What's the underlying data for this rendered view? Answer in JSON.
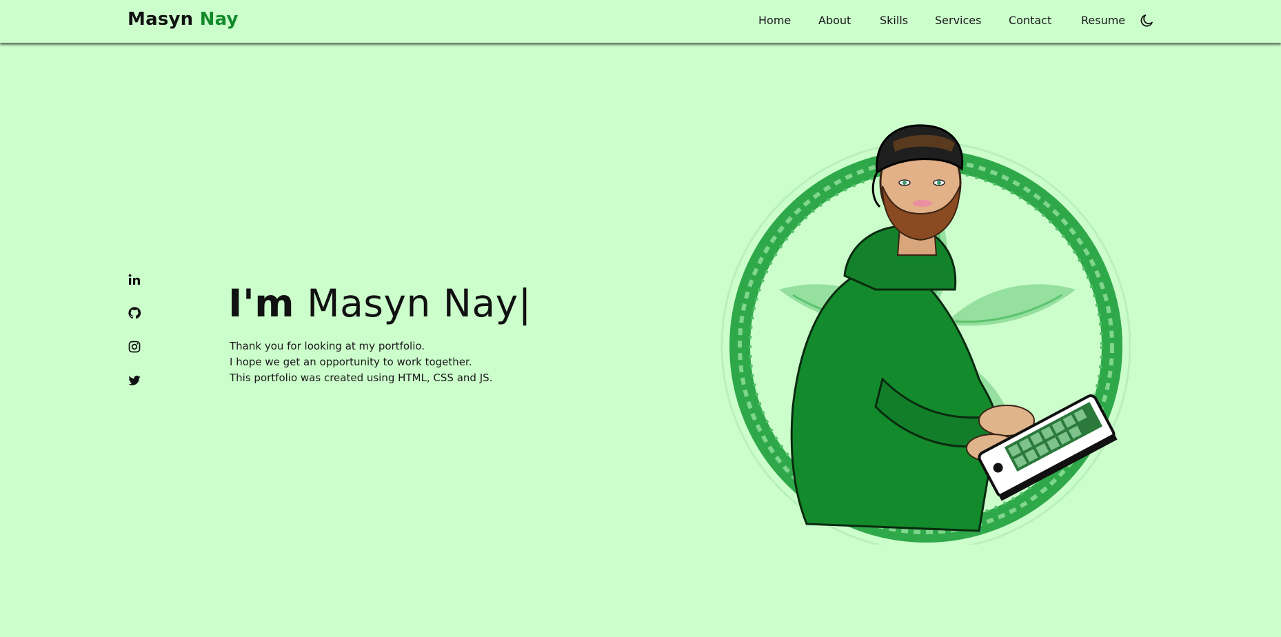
{
  "brand": {
    "first": "Masyn",
    "second": "Nay",
    "accent_color": "#128a2c"
  },
  "nav": {
    "items": [
      {
        "label": "Home"
      },
      {
        "label": "About"
      },
      {
        "label": "Skills"
      },
      {
        "label": "Services"
      },
      {
        "label": "Contact"
      },
      {
        "label": "Resume"
      }
    ],
    "theme_toggle_icon": "moon-icon"
  },
  "social": [
    {
      "icon": "linkedin-icon"
    },
    {
      "icon": "github-icon"
    },
    {
      "icon": "instagram-icon"
    },
    {
      "icon": "twitter-icon"
    }
  ],
  "hero": {
    "greeting": "I'm",
    "name": "Masyn Nay",
    "cursor": "|",
    "lines": [
      "Thank you for looking at my portfolio.",
      "I hope we get an opportunity to work together.",
      "This portfolio was created using HTML, CSS and JS."
    ],
    "image_icon": "avatar-illustration",
    "colors": {
      "background": "#ccfecc",
      "hoodie": "#138a2b",
      "ring": "#2fa84a"
    }
  }
}
